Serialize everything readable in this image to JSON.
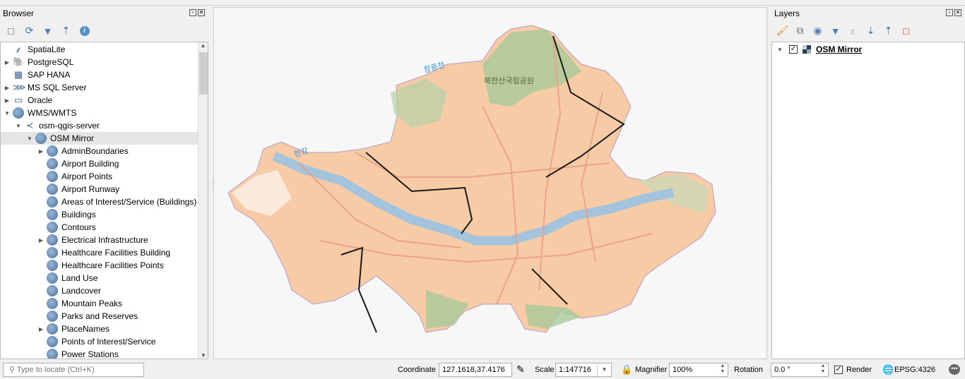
{
  "browser": {
    "title": "Browser",
    "toolbar": [
      "add-icon",
      "refresh-icon",
      "filter-icon",
      "collapse-icon",
      "info-icon"
    ],
    "items": [
      {
        "label": "SpatiaLite",
        "level": 0,
        "expander": "",
        "icon": "feather-icon"
      },
      {
        "label": "PostgreSQL",
        "level": 0,
        "expander": "right",
        "icon": "elephant-icon"
      },
      {
        "label": "SAP HANA",
        "level": 0,
        "expander": "",
        "icon": "hana-icon"
      },
      {
        "label": "MS SQL Server",
        "level": 0,
        "expander": "right",
        "icon": "mssql-icon"
      },
      {
        "label": "Oracle",
        "level": 0,
        "expander": "right",
        "icon": "oracle-icon"
      },
      {
        "label": "WMS/WMTS",
        "level": 0,
        "expander": "down",
        "icon": "globe-icon"
      },
      {
        "label": "osm-qgis-server",
        "level": 1,
        "expander": "down",
        "icon": "connection-icon"
      },
      {
        "label": "OSM Mirror",
        "level": 2,
        "expander": "down",
        "icon": "globe-icon",
        "selected": true
      },
      {
        "label": "AdminBoundaries",
        "level": 3,
        "expander": "right",
        "icon": "globe-icon"
      },
      {
        "label": "Airport Building",
        "level": 3,
        "expander": "",
        "icon": "globe-icon"
      },
      {
        "label": "Airport Points",
        "level": 3,
        "expander": "",
        "icon": "globe-icon"
      },
      {
        "label": "Airport Runway",
        "level": 3,
        "expander": "",
        "icon": "globe-icon"
      },
      {
        "label": "Areas of Interest/Service (Buildings)",
        "level": 3,
        "expander": "",
        "icon": "globe-icon"
      },
      {
        "label": "Buildings",
        "level": 3,
        "expander": "",
        "icon": "globe-icon"
      },
      {
        "label": "Contours",
        "level": 3,
        "expander": "",
        "icon": "globe-icon"
      },
      {
        "label": "Electrical Infrastructure",
        "level": 3,
        "expander": "right",
        "icon": "globe-icon"
      },
      {
        "label": "Healthcare Facilities Building",
        "level": 3,
        "expander": "",
        "icon": "globe-icon"
      },
      {
        "label": "Healthcare Facilities Points",
        "level": 3,
        "expander": "",
        "icon": "globe-icon"
      },
      {
        "label": "Land Use",
        "level": 3,
        "expander": "",
        "icon": "globe-icon"
      },
      {
        "label": "Landcover",
        "level": 3,
        "expander": "",
        "icon": "globe-icon"
      },
      {
        "label": "Mountain Peaks",
        "level": 3,
        "expander": "",
        "icon": "globe-icon"
      },
      {
        "label": "Parks and Reserves",
        "level": 3,
        "expander": "",
        "icon": "globe-icon"
      },
      {
        "label": "PlaceNames",
        "level": 3,
        "expander": "right",
        "icon": "globe-icon"
      },
      {
        "label": "Points of Interest/Service",
        "level": 3,
        "expander": "",
        "icon": "globe-icon"
      },
      {
        "label": "Power Stations",
        "level": 3,
        "expander": "",
        "icon": "globe-icon"
      }
    ]
  },
  "map": {
    "labels": {
      "river1": "창릉천",
      "park": "북한산국립공원",
      "river2": "한강"
    }
  },
  "layers": {
    "title": "Layers",
    "items": [
      {
        "label": "OSM Mirror",
        "checked": true
      }
    ]
  },
  "status": {
    "locate_placeholder": "Type to locate (Ctrl+K)",
    "coordinate_label": "Coordinate",
    "coordinate": "127.1618,37.4176",
    "scale_label": "Scale",
    "scale": "1:147716",
    "magnifier_label": "Magnifier",
    "magnifier": "100%",
    "rotation_label": "Rotation",
    "rotation": "0.0 °",
    "render_label": "Render",
    "render_checked": true,
    "crs": "EPSG:4326"
  }
}
